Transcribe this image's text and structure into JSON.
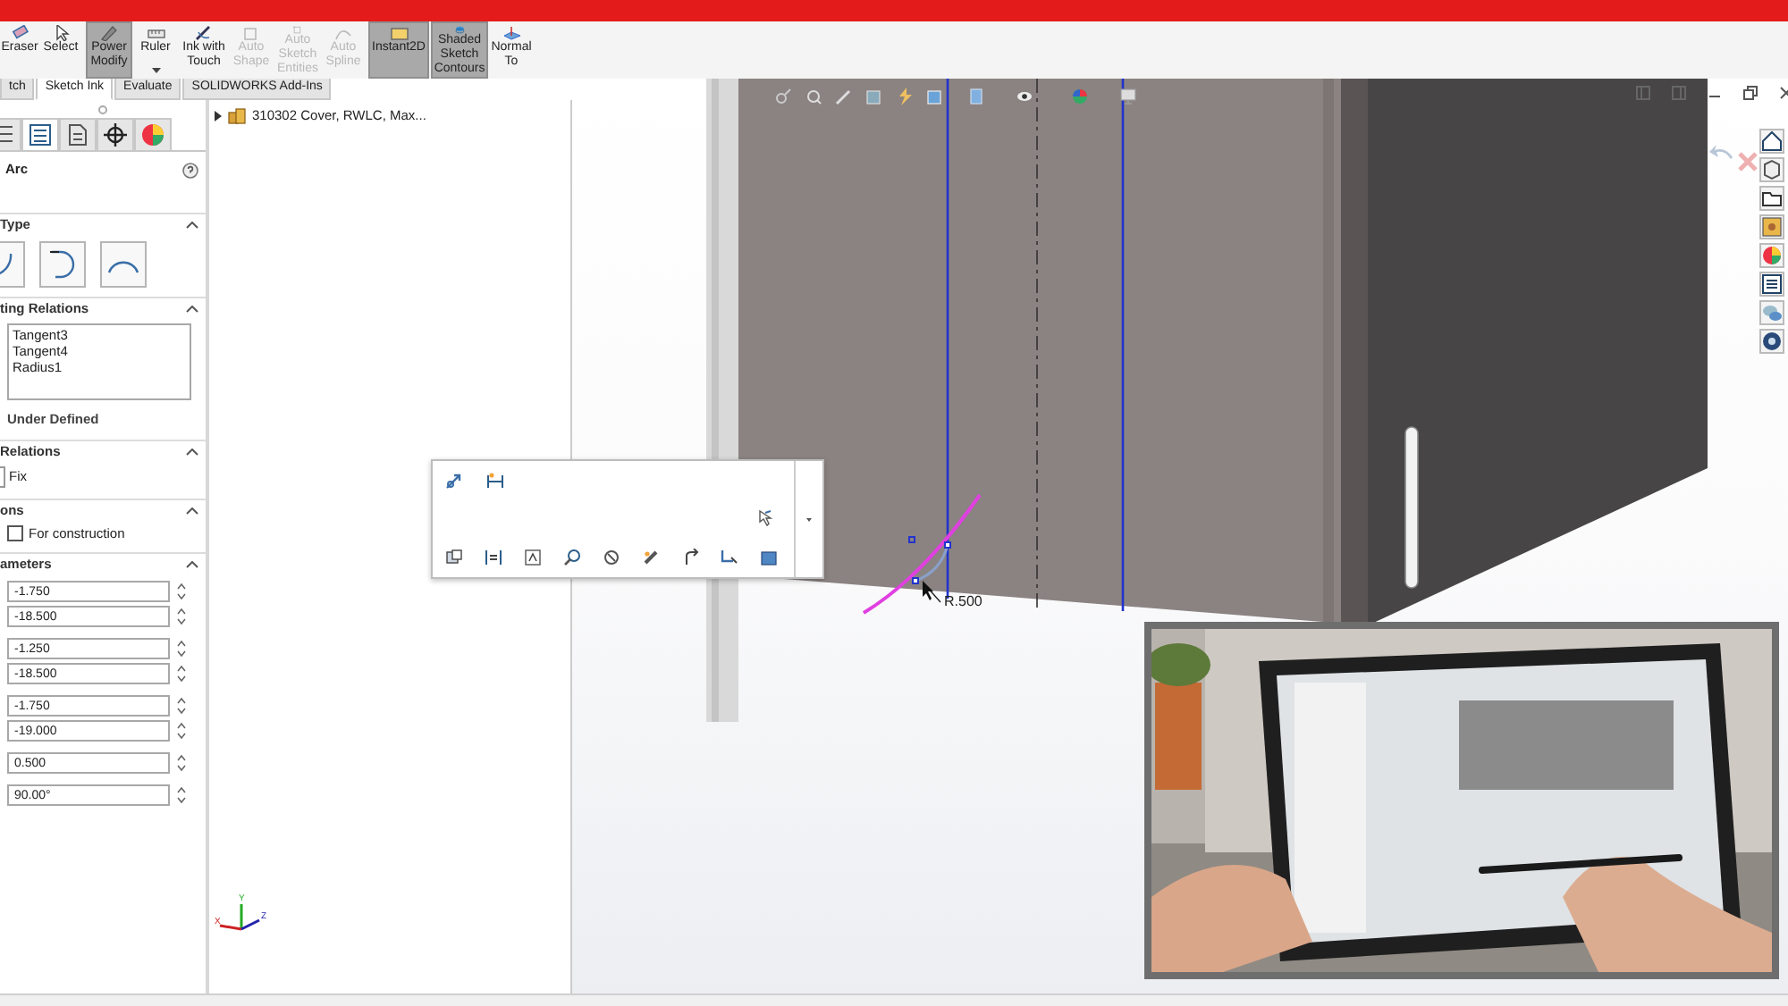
{
  "toolbar": {
    "buttons": [
      {
        "kind": "eraser",
        "label": "Eraser",
        "selected": false,
        "disabled": false
      },
      {
        "kind": "select",
        "label": "Select",
        "selected": false,
        "disabled": false
      },
      {
        "kind": "modify",
        "label": "Power Modify",
        "selected": true,
        "disabled": false
      },
      {
        "kind": "ruler",
        "label": "Ruler",
        "selected": false,
        "disabled": false,
        "dropdown": true
      },
      {
        "kind": "ink",
        "label": "Ink with Touch",
        "selected": false,
        "disabled": false
      },
      {
        "kind": "shape",
        "label": "Auto Shape",
        "selected": false,
        "disabled": true
      },
      {
        "kind": "entities",
        "label": "Auto Sketch Entities",
        "selected": false,
        "disabled": true
      },
      {
        "kind": "spline",
        "label": "Auto Spline",
        "selected": false,
        "disabled": true
      },
      {
        "kind": "instant2d",
        "label": "Instant2D",
        "selected": true,
        "disabled": false
      },
      {
        "kind": "contours",
        "label": "Shaded Sketch Contours",
        "selected": true,
        "disabled": false
      },
      {
        "kind": "normal",
        "label": "Normal To",
        "selected": false,
        "disabled": false
      }
    ]
  },
  "tabs": [
    {
      "label": "tch",
      "selected": false
    },
    {
      "label": "Sketch Ink",
      "selected": true
    },
    {
      "label": "Evaluate",
      "selected": false
    },
    {
      "label": "SOLIDWORKS Add-Ins",
      "selected": false
    }
  ],
  "property_manager": {
    "panel_tabs": [
      {
        "kind": "tree",
        "selected": false
      },
      {
        "kind": "properties",
        "selected": true
      },
      {
        "kind": "config",
        "selected": false
      },
      {
        "kind": "target",
        "selected": false
      },
      {
        "kind": "appearance",
        "selected": false
      }
    ],
    "title": "Arc",
    "type_section": {
      "heading": "Type",
      "expanded": true,
      "arc_types": [
        {
          "kind": "center"
        },
        {
          "kind": "tangent"
        },
        {
          "kind": "three-point"
        }
      ]
    },
    "existing_relations": {
      "heading": "ting Relations",
      "expanded": true,
      "items": [
        "Tangent3",
        "Tangent4",
        "Radius1"
      ],
      "status": "Under Defined"
    },
    "add_relations": {
      "heading": "Relations",
      "expanded": true,
      "items": [
        "Fix"
      ]
    },
    "options": {
      "heading": "ons",
      "expanded": true,
      "label": "For construction",
      "checked": false
    },
    "parameters": {
      "heading": "ameters",
      "expanded": true,
      "groups": [
        [
          "-1.750",
          "-18.500"
        ],
        [
          "-1.250",
          "-18.500"
        ],
        [
          "-1.750",
          "-19.000"
        ],
        [
          "0.500"
        ],
        [
          "90.00°"
        ]
      ]
    }
  },
  "tree": {
    "items": [
      {
        "label": "310302 Cover, RWLC, Max...",
        "expanded": false
      }
    ]
  },
  "viewport": {
    "dimension": "R.500",
    "triad": [
      "Y",
      "X",
      "Z"
    ]
  }
}
